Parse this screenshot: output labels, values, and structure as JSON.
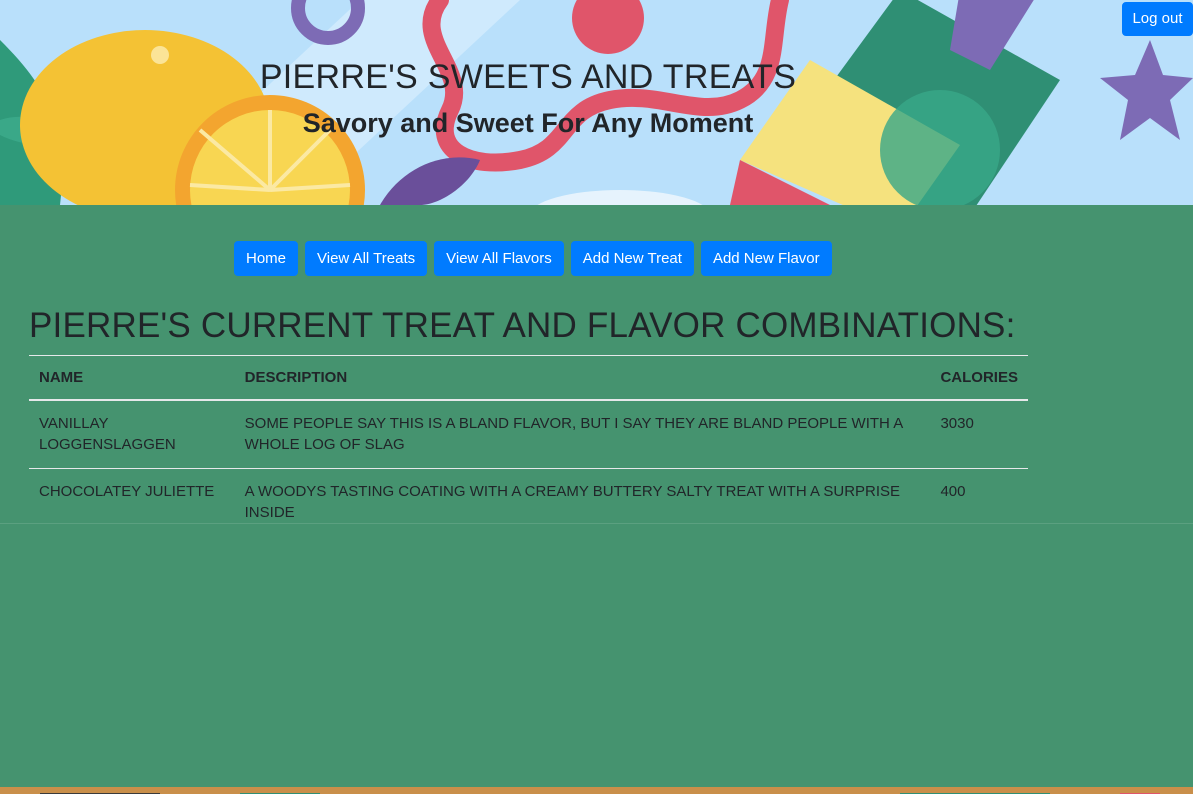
{
  "header": {
    "title": "PIERRE'S SWEETS AND TREATS",
    "subtitle": "Savory and Sweet For Any Moment",
    "logout_label": "Log out"
  },
  "nav": {
    "items": [
      {
        "label": "Home"
      },
      {
        "label": "View All Treats"
      },
      {
        "label": "View All Flavors"
      },
      {
        "label": "Add New Treat"
      },
      {
        "label": "Add New Flavor"
      }
    ]
  },
  "main": {
    "heading": "PIERRE'S CURRENT TREAT AND FLAVOR COMBINATIONS:",
    "table": {
      "columns": [
        "NAME",
        "DESCRIPTION",
        "CALORIES"
      ],
      "rows": [
        {
          "name": "VANILLAY LOGGENSLAGGEN",
          "description": "SOME PEOPLE SAY THIS IS A BLAND FLAVOR, BUT I SAY THEY ARE BLAND PEOPLE WITH A WHOLE LOG OF SLAG",
          "calories": "3030"
        },
        {
          "name": "CHOCOLATEY JULIETTE",
          "description": "A WOODYS TASTING COATING WITH A CREAMY BUTTERY SALTY TREAT WITH A SURPRISE INSIDE",
          "calories": "400"
        }
      ]
    }
  },
  "colors": {
    "page_background": "#45936f",
    "button": "#007bff",
    "hero_sky": "#b9e0fb"
  }
}
